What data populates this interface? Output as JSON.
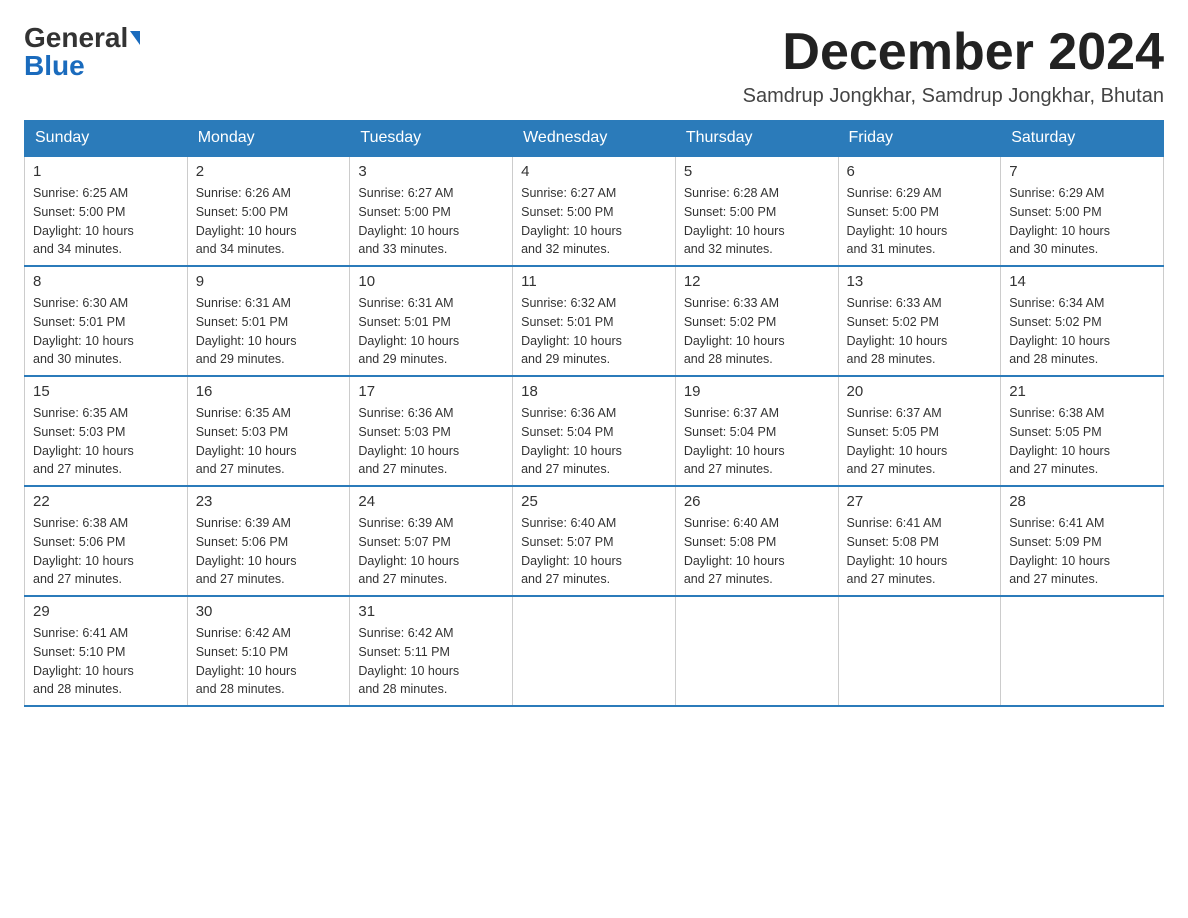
{
  "logo": {
    "general": "General",
    "blue": "Blue"
  },
  "title": "December 2024",
  "subtitle": "Samdrup Jongkhar, Samdrup Jongkhar, Bhutan",
  "days_of_week": [
    "Sunday",
    "Monday",
    "Tuesday",
    "Wednesday",
    "Thursday",
    "Friday",
    "Saturday"
  ],
  "weeks": [
    [
      {
        "day": "1",
        "sunrise": "6:25 AM",
        "sunset": "5:00 PM",
        "daylight": "10 hours and 34 minutes."
      },
      {
        "day": "2",
        "sunrise": "6:26 AM",
        "sunset": "5:00 PM",
        "daylight": "10 hours and 34 minutes."
      },
      {
        "day": "3",
        "sunrise": "6:27 AM",
        "sunset": "5:00 PM",
        "daylight": "10 hours and 33 minutes."
      },
      {
        "day": "4",
        "sunrise": "6:27 AM",
        "sunset": "5:00 PM",
        "daylight": "10 hours and 32 minutes."
      },
      {
        "day": "5",
        "sunrise": "6:28 AM",
        "sunset": "5:00 PM",
        "daylight": "10 hours and 32 minutes."
      },
      {
        "day": "6",
        "sunrise": "6:29 AM",
        "sunset": "5:00 PM",
        "daylight": "10 hours and 31 minutes."
      },
      {
        "day": "7",
        "sunrise": "6:29 AM",
        "sunset": "5:00 PM",
        "daylight": "10 hours and 30 minutes."
      }
    ],
    [
      {
        "day": "8",
        "sunrise": "6:30 AM",
        "sunset": "5:01 PM",
        "daylight": "10 hours and 30 minutes."
      },
      {
        "day": "9",
        "sunrise": "6:31 AM",
        "sunset": "5:01 PM",
        "daylight": "10 hours and 29 minutes."
      },
      {
        "day": "10",
        "sunrise": "6:31 AM",
        "sunset": "5:01 PM",
        "daylight": "10 hours and 29 minutes."
      },
      {
        "day": "11",
        "sunrise": "6:32 AM",
        "sunset": "5:01 PM",
        "daylight": "10 hours and 29 minutes."
      },
      {
        "day": "12",
        "sunrise": "6:33 AM",
        "sunset": "5:02 PM",
        "daylight": "10 hours and 28 minutes."
      },
      {
        "day": "13",
        "sunrise": "6:33 AM",
        "sunset": "5:02 PM",
        "daylight": "10 hours and 28 minutes."
      },
      {
        "day": "14",
        "sunrise": "6:34 AM",
        "sunset": "5:02 PM",
        "daylight": "10 hours and 28 minutes."
      }
    ],
    [
      {
        "day": "15",
        "sunrise": "6:35 AM",
        "sunset": "5:03 PM",
        "daylight": "10 hours and 27 minutes."
      },
      {
        "day": "16",
        "sunrise": "6:35 AM",
        "sunset": "5:03 PM",
        "daylight": "10 hours and 27 minutes."
      },
      {
        "day": "17",
        "sunrise": "6:36 AM",
        "sunset": "5:03 PM",
        "daylight": "10 hours and 27 minutes."
      },
      {
        "day": "18",
        "sunrise": "6:36 AM",
        "sunset": "5:04 PM",
        "daylight": "10 hours and 27 minutes."
      },
      {
        "day": "19",
        "sunrise": "6:37 AM",
        "sunset": "5:04 PM",
        "daylight": "10 hours and 27 minutes."
      },
      {
        "day": "20",
        "sunrise": "6:37 AM",
        "sunset": "5:05 PM",
        "daylight": "10 hours and 27 minutes."
      },
      {
        "day": "21",
        "sunrise": "6:38 AM",
        "sunset": "5:05 PM",
        "daylight": "10 hours and 27 minutes."
      }
    ],
    [
      {
        "day": "22",
        "sunrise": "6:38 AM",
        "sunset": "5:06 PM",
        "daylight": "10 hours and 27 minutes."
      },
      {
        "day": "23",
        "sunrise": "6:39 AM",
        "sunset": "5:06 PM",
        "daylight": "10 hours and 27 minutes."
      },
      {
        "day": "24",
        "sunrise": "6:39 AM",
        "sunset": "5:07 PM",
        "daylight": "10 hours and 27 minutes."
      },
      {
        "day": "25",
        "sunrise": "6:40 AM",
        "sunset": "5:07 PM",
        "daylight": "10 hours and 27 minutes."
      },
      {
        "day": "26",
        "sunrise": "6:40 AM",
        "sunset": "5:08 PM",
        "daylight": "10 hours and 27 minutes."
      },
      {
        "day": "27",
        "sunrise": "6:41 AM",
        "sunset": "5:08 PM",
        "daylight": "10 hours and 27 minutes."
      },
      {
        "day": "28",
        "sunrise": "6:41 AM",
        "sunset": "5:09 PM",
        "daylight": "10 hours and 27 minutes."
      }
    ],
    [
      {
        "day": "29",
        "sunrise": "6:41 AM",
        "sunset": "5:10 PM",
        "daylight": "10 hours and 28 minutes."
      },
      {
        "day": "30",
        "sunrise": "6:42 AM",
        "sunset": "5:10 PM",
        "daylight": "10 hours and 28 minutes."
      },
      {
        "day": "31",
        "sunrise": "6:42 AM",
        "sunset": "5:11 PM",
        "daylight": "10 hours and 28 minutes."
      },
      null,
      null,
      null,
      null
    ]
  ],
  "labels": {
    "sunrise": "Sunrise:",
    "sunset": "Sunset:",
    "daylight": "Daylight:"
  }
}
